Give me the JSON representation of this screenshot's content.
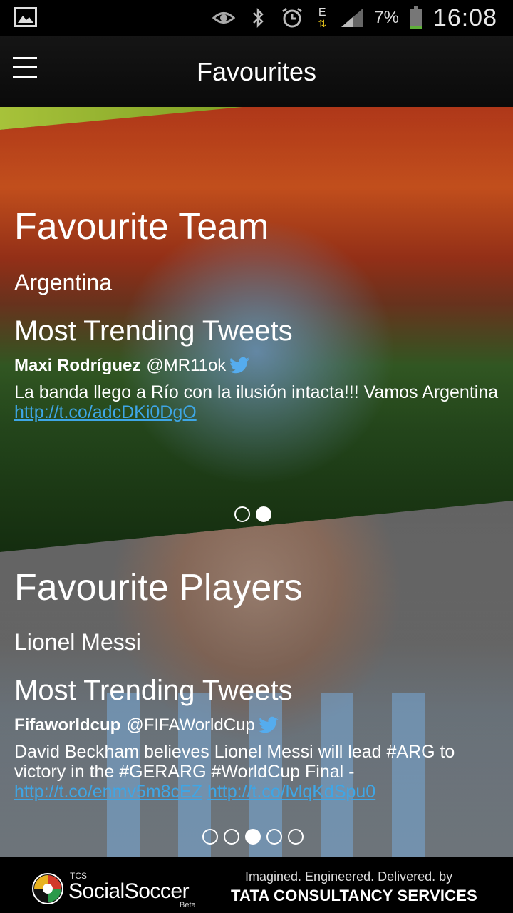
{
  "status_bar": {
    "battery": "7%",
    "network": "E",
    "time": "16:08"
  },
  "header": {
    "title": "Favourites"
  },
  "team_section": {
    "title": "Favourite Team",
    "team": "Argentina",
    "trending_title": "Most Trending Tweets",
    "tweet": {
      "author": "Maxi Rodríguez",
      "handle": "@MR11ok",
      "text": "La banda llego a Río con la ilusión intacta!!! Vamos Argentina",
      "link": "http://t.co/adcDKi0DgO"
    },
    "pager": {
      "count": 2,
      "active": 2
    }
  },
  "players_section": {
    "title": "Favourite Players",
    "player": "Lionel Messi",
    "trending_title": "Most Trending Tweets",
    "tweet": {
      "author": "Fifaworldcup",
      "handle": "@FIFAWorldCup",
      "text": "David Beckham believes Lionel Messi will lead #ARG to victory in the #GERARG #WorldCup Final -",
      "link1": "http://t.co/enmv5m8cEZ",
      "link2": "http://t.co/lvlqKdSpu0"
    },
    "pager": {
      "count": 5,
      "active": 3
    }
  },
  "footer": {
    "brand_small": "TCS",
    "brand_name": "SocialSoccer",
    "brand_badge": "Beta",
    "tagline": "Imagined. Engineered. Delivered. by",
    "company": "TATA CONSULTANCY SERVICES"
  },
  "colors": {
    "link": "#3ea6e6",
    "twitter": "#55acee",
    "accent": "#a7c23a"
  }
}
